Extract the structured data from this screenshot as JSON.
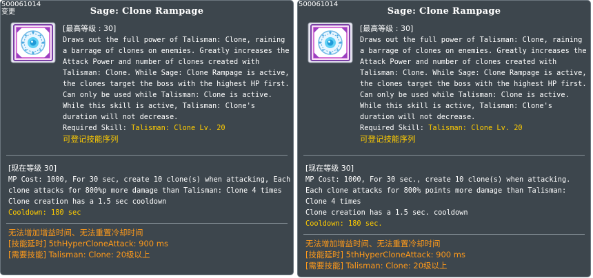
{
  "tooltips": [
    {
      "skill_id": "500061014",
      "tag": "变更",
      "title": "Sage: Clone Rampage",
      "icon": "talisman-clone-skill-icon",
      "max_level_label": "[最高等级 : 30]",
      "description_lines": [
        "Draws out the full power of Talisman: Clone, raining",
        "a barrage of clones on enemies. Greatly increases the",
        "Attack Power and number of clones created with",
        "Talisman: Clone. While Sage: Clone Rampage is active,",
        "the clones target the boss with the highest HP first.",
        "Can only be used while Talisman: Clone is active.",
        "While this skill is active, Talisman: Clone's",
        "duration will not decrease."
      ],
      "required_skill_prefix": "Required Skill: ",
      "required_skill_value": "Talisman: Clone Lv. 20",
      "sequence_note": "可登记技能序列",
      "current_level_label": "[现在等级 30]",
      "effect_lines": [
        "MP Cost: 1000, For 30 sec, create 10 clone(s) when attacking, Each",
        "clone attacks for 800%p more damage than Talisman: Clone 4 times",
        "Clone creation has a 1.5 sec cooldown"
      ],
      "cooldown": "Cooldown: 180 sec",
      "extra_lines": [
        "无法增加增益时间、无法重置冷却时间",
        "[技能延时] 5thHyperCloneAttack: 900 ms",
        "[需要技能] Talisman: Clone: 20级以上"
      ]
    },
    {
      "skill_id": "500061014",
      "tag": "",
      "title": "Sage: Clone Rampage",
      "icon": "talisman-clone-skill-icon",
      "max_level_label": "[最高等级 : 30]",
      "description_lines": [
        "Draws out the full power of Talisman: Clone, raining",
        "a barrage of clones on enemies. Greatly increases the",
        "Attack Power and number of clones created with",
        "Talisman: Clone. While Sage: Clone Rampage is active,",
        "the clones target the boss with the highest HP first.",
        "Can only be used while Talisman: Clone is active.",
        "While this skill is active, Talisman: Clone's",
        "duration will not decrease."
      ],
      "required_skill_prefix": "Required Skill: ",
      "required_skill_value": "Talisman: Clone Lv. 20",
      "sequence_note": "可登记技能序列",
      "current_level_label": "[现在等级 30]",
      "effect_lines": [
        "MP Cost: 1000, For 30 sec., create 10 clone(s) when attacking.",
        "Each clone attacks for 800% points more damage than Talisman:",
        "Clone 4 times",
        "Clone creation has a 1.5 sec. cooldown"
      ],
      "cooldown": "Cooldown: 180 sec.",
      "extra_lines": [
        "无法增加增益时间、无法重置冷却时间",
        "[技能延时] 5thHyperCloneAttack: 900 ms",
        "[需要技能] Talisman: Clone: 20级以上"
      ]
    }
  ],
  "colors": {
    "background": "#3d464d",
    "border": "#6b767e",
    "text": "#ffffff",
    "highlight": "#ffcc00",
    "accent": "#ff9a1a"
  }
}
